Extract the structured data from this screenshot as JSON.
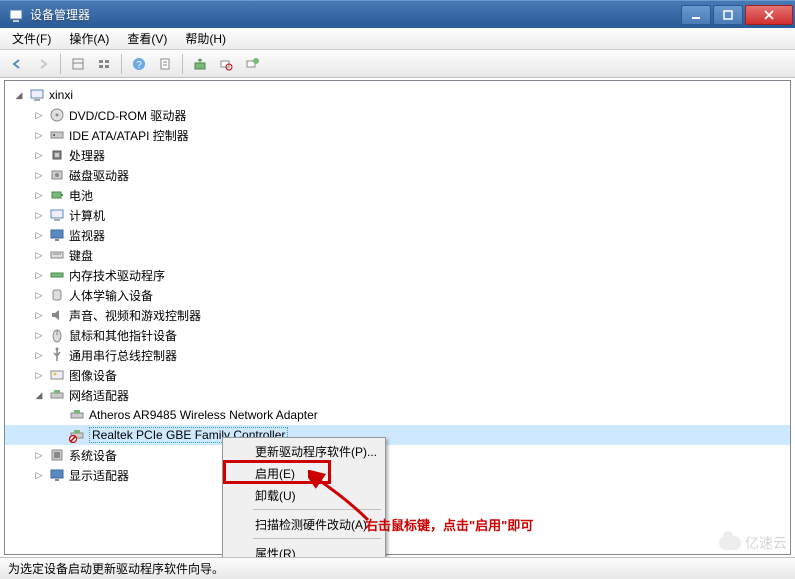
{
  "window": {
    "title": "设备管理器"
  },
  "menubar": [
    {
      "label": "文件(F)"
    },
    {
      "label": "操作(A)"
    },
    {
      "label": "查看(V)"
    },
    {
      "label": "帮助(H)"
    }
  ],
  "tree": {
    "root": "xinxi",
    "categories": [
      {
        "label": "DVD/CD-ROM 驱动器",
        "icon": "disc"
      },
      {
        "label": "IDE ATA/ATAPI 控制器",
        "icon": "ide"
      },
      {
        "label": "处理器",
        "icon": "cpu"
      },
      {
        "label": "磁盘驱动器",
        "icon": "disk"
      },
      {
        "label": "电池",
        "icon": "battery"
      },
      {
        "label": "计算机",
        "icon": "computer"
      },
      {
        "label": "监视器",
        "icon": "monitor"
      },
      {
        "label": "键盘",
        "icon": "keyboard"
      },
      {
        "label": "内存技术驱动程序",
        "icon": "memory"
      },
      {
        "label": "人体学输入设备",
        "icon": "hid"
      },
      {
        "label": "声音、视频和游戏控制器",
        "icon": "sound"
      },
      {
        "label": "鼠标和其他指针设备",
        "icon": "mouse"
      },
      {
        "label": "通用串行总线控制器",
        "icon": "usb"
      },
      {
        "label": "图像设备",
        "icon": "image"
      },
      {
        "label": "网络适配器",
        "icon": "network",
        "expanded": true,
        "children": [
          {
            "label": "Atheros AR9485 Wireless Network Adapter",
            "icon": "netadapter"
          },
          {
            "label": "Realtek PCIe GBE Family Controller",
            "icon": "netadapter",
            "selected": true,
            "disabled": true
          }
        ]
      },
      {
        "label": "系统设备",
        "icon": "system"
      },
      {
        "label": "显示适配器",
        "icon": "display"
      }
    ]
  },
  "context_menu": [
    {
      "label": "更新驱动程序软件(P)..."
    },
    {
      "label": "启用(E)"
    },
    {
      "label": "卸载(U)"
    },
    {
      "sep": true
    },
    {
      "label": "扫描检测硬件改动(A)"
    },
    {
      "sep": true
    },
    {
      "label": "属性(R)"
    }
  ],
  "annotation": "右击鼠标键，点击\"启用\"即可",
  "statusbar": "为选定设备启动更新驱动程序软件向导。",
  "watermark": "亿速云"
}
